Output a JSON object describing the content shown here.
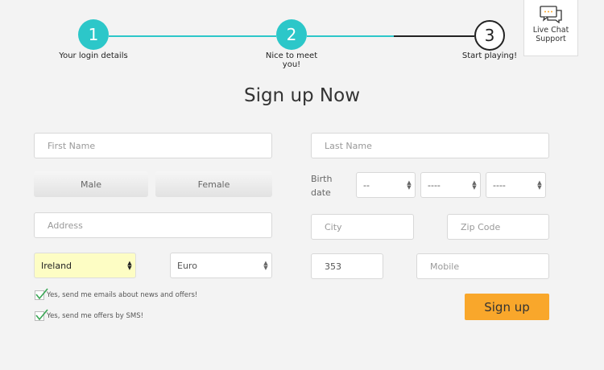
{
  "steps": [
    {
      "number": "1",
      "label": "Your login details"
    },
    {
      "number": "2",
      "label": "Nice to meet you!"
    },
    {
      "number": "3",
      "label": "Start playing!"
    }
  ],
  "chat": {
    "line1": "Live Chat",
    "line2": "Support",
    "icon": "chat-bubble-icon"
  },
  "title": "Sign up Now",
  "form": {
    "first_name_placeholder": "First Name",
    "last_name_placeholder": "Last Name",
    "male_label": "Male",
    "female_label": "Female",
    "birth_label": "Birth date",
    "birth_day": "--",
    "birth_month": "----",
    "birth_year": "----",
    "address_placeholder": "Address",
    "city_placeholder": "City",
    "zip_placeholder": "Zip Code",
    "country": "Ireland",
    "currency": "Euro",
    "phone_prefix": "353",
    "mobile_placeholder": "Mobile",
    "email_optin": "Yes, send me emails about news and offers!",
    "sms_optin": "Yes, send me offers by SMS!",
    "submit_label": "Sign up"
  },
  "colors": {
    "accent": "#2cc7c9",
    "button": "#f9a72b",
    "country_highlight": "#fdfdc4"
  }
}
